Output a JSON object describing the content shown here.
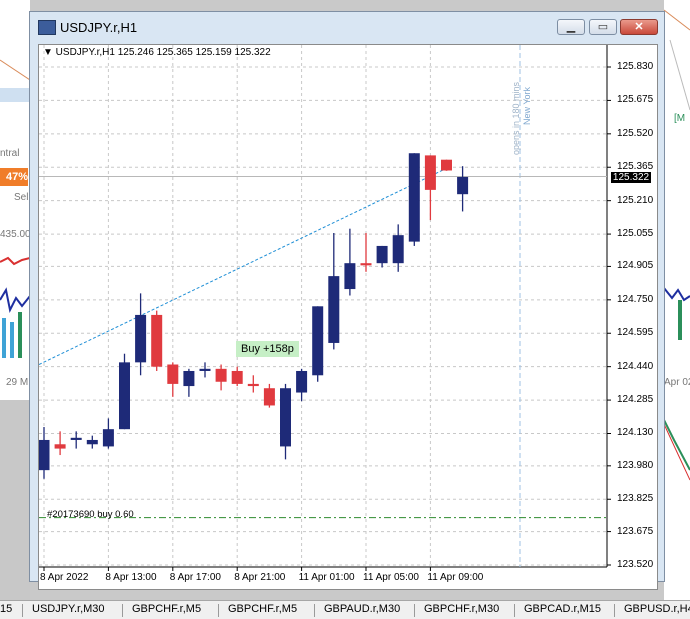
{
  "window": {
    "title": "USDJPY.r,H1",
    "buttons": {
      "minimize": "▁",
      "maximize": "▭",
      "close": "✕"
    }
  },
  "chart": {
    "symbol_line": "▼ USDJPY.r,H1  125.246 125.365 125.159 125.322",
    "current_price": "125.322",
    "price_labels": [
      "125.830",
      "125.675",
      "125.520",
      "125.365",
      "125.210",
      "125.055",
      "124.905",
      "124.750",
      "124.595",
      "124.440",
      "124.285",
      "124.130",
      "123.980",
      "123.825",
      "123.675",
      "123.520"
    ],
    "time_labels": [
      "8 Apr 2022",
      "8 Apr 13:00",
      "8 Apr 17:00",
      "8 Apr 21:00",
      "11 Apr 01:00",
      "11 Apr 05:00",
      "11 Apr 09:00"
    ],
    "trade_label": "Buy +158p",
    "order_label": "#20173690 buy 0.60",
    "session_labels": [
      "opens in 180 mins",
      "New York"
    ]
  },
  "chart_data": {
    "type": "candlestick",
    "title": "USDJPY.r,H1",
    "ylim": [
      123.45,
      125.95
    ],
    "bull_color": "#1e2a78",
    "bear_color": "#e03a3f",
    "x": [
      "8 Apr 09:00",
      "8 Apr 10:00",
      "8 Apr 11:00",
      "8 Apr 12:00",
      "8 Apr 13:00",
      "8 Apr 14:00",
      "8 Apr 15:00",
      "8 Apr 16:00",
      "8 Apr 17:00",
      "8 Apr 18:00",
      "8 Apr 19:00",
      "8 Apr 20:00",
      "8 Apr 21:00",
      "8 Apr 22:00",
      "8 Apr 23:00",
      "11 Apr 00:00",
      "11 Apr 01:00",
      "11 Apr 02:00",
      "11 Apr 03:00",
      "11 Apr 04:00",
      "11 Apr 05:00",
      "11 Apr 06:00",
      "11 Apr 07:00",
      "11 Apr 08:00",
      "11 Apr 09:00",
      "11 Apr 10:00",
      "11 Apr 11:00"
    ],
    "open": [
      123.96,
      124.08,
      124.1,
      124.08,
      124.07,
      124.15,
      124.46,
      124.68,
      124.45,
      124.35,
      124.42,
      124.43,
      124.42,
      124.36,
      124.34,
      124.07,
      124.32,
      124.4,
      124.55,
      124.8,
      124.92,
      124.92,
      124.92,
      125.02,
      125.42,
      125.4,
      125.24
    ],
    "close": [
      124.1,
      124.06,
      124.11,
      124.1,
      124.15,
      124.46,
      124.68,
      124.44,
      124.36,
      124.42,
      124.43,
      124.37,
      124.36,
      124.35,
      124.26,
      124.34,
      124.42,
      124.72,
      124.86,
      124.92,
      124.91,
      125.0,
      125.05,
      125.43,
      125.26,
      125.35,
      125.32
    ],
    "high": [
      124.16,
      124.14,
      124.14,
      124.12,
      124.2,
      124.5,
      124.78,
      124.7,
      124.46,
      124.43,
      124.46,
      124.45,
      124.44,
      124.4,
      124.36,
      124.36,
      124.43,
      124.72,
      125.06,
      125.08,
      125.06,
      125.0,
      125.1,
      125.43,
      125.42,
      125.4,
      125.37
    ],
    "low": [
      123.92,
      124.03,
      124.06,
      124.06,
      124.06,
      124.15,
      124.4,
      124.42,
      124.3,
      124.3,
      124.39,
      124.33,
      124.35,
      124.32,
      124.25,
      124.01,
      124.28,
      124.37,
      124.52,
      124.77,
      124.88,
      124.9,
      124.88,
      125.0,
      125.12,
      125.36,
      125.16
    ],
    "buy_line": {
      "from": [
        "8 Apr 09:00",
        124.45
      ],
      "to": [
        "11 Apr 10:00",
        125.36
      ],
      "color": "#1f8fd6"
    },
    "order_level": 123.74,
    "current_price": 125.322
  },
  "tabs": [
    "15",
    "USDJPY.r,M30",
    "GBPCHF.r,M5",
    "GBPCHF.r,M5",
    "GBPAUD.r,M30",
    "GBPCHF.r,M30",
    "GBPCAD.r,M15",
    "GBPUSD.r,H4"
  ],
  "background": {
    "left_orange": "47%",
    "left_texts": [
      "ntral",
      "Sel",
      "435.00",
      "29 M"
    ],
    "right_texts": [
      "[M",
      "Apr 02:3"
    ]
  }
}
